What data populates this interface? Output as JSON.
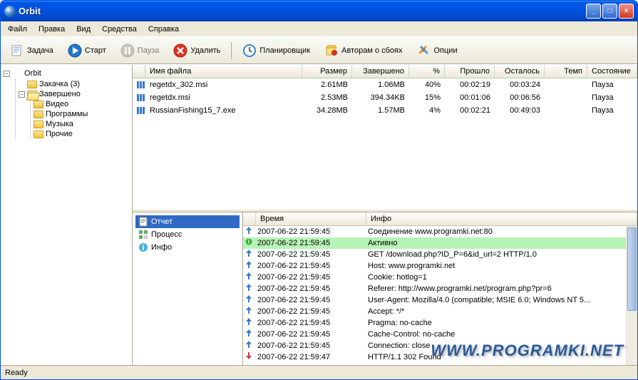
{
  "app_title": "Orbit",
  "menu": [
    "Файл",
    "Правка",
    "Вид",
    "Средства",
    "Справка"
  ],
  "toolbar": [
    {
      "label": "Задача",
      "icon": "new"
    },
    {
      "label": "Старт",
      "icon": "play"
    },
    {
      "label": "Пауза",
      "icon": "pause",
      "disabled": true
    },
    {
      "label": "Удалить",
      "icon": "delete"
    },
    {
      "sep": true
    },
    {
      "label": "Планировщик",
      "icon": "sched"
    },
    {
      "label": "Авторам о сбоях",
      "icon": "bug"
    },
    {
      "label": "Опции",
      "icon": "opts"
    }
  ],
  "tree": {
    "root": "Orbit",
    "n1": "Закачка  (3)",
    "n2": "Завершено",
    "c1": "Видео",
    "c2": "Программы",
    "c3": "Музыка",
    "c4": "Прочие"
  },
  "columns": {
    "name": "Имя файла",
    "size": "Размер",
    "done": "Завершено",
    "pct": "%",
    "elapsed": "Прошло",
    "remain": "Осталось",
    "temp": "Темп",
    "state": "Состояние"
  },
  "rows": [
    {
      "name": "regetdx_302.msi",
      "size": "2.61MB",
      "done": "1.06MB",
      "pct": "40%",
      "elapsed": "00:02:19",
      "remain": "00:03:24",
      "temp": "",
      "state": "Пауза"
    },
    {
      "name": "regetdx.msi",
      "size": "2.53MB",
      "done": "394.34KB",
      "pct": "15%",
      "elapsed": "00:01:06",
      "remain": "00:06:56",
      "temp": "",
      "state": "Пауза"
    },
    {
      "name": "RussianFishing15_7.exe",
      "size": "34.28MB",
      "done": "1.57MB",
      "pct": "4%",
      "elapsed": "00:02:21",
      "remain": "00:49:03",
      "temp": "",
      "state": "Пауза"
    }
  ],
  "tabs": {
    "report": "Отчет",
    "process": "Процесс",
    "info": "Инфо"
  },
  "log_cols": {
    "time": "Время",
    "info": "Инфо"
  },
  "log": [
    {
      "t": "2007-06-22 21:59:45",
      "i": "Соединение www.programki.net:80",
      "type": "up"
    },
    {
      "t": "2007-06-22 21:59:45",
      "i": "Активно",
      "type": "active"
    },
    {
      "t": "2007-06-22 21:59:45",
      "i": "GET /download.php?ID_P=6&id_url=2 HTTP/1.0",
      "type": "up"
    },
    {
      "t": "2007-06-22 21:59:45",
      "i": "Host: www.programki.net",
      "type": "up"
    },
    {
      "t": "2007-06-22 21:59:45",
      "i": "Cookie: hotlog=1",
      "type": "up"
    },
    {
      "t": "2007-06-22 21:59:45",
      "i": "Referer: http://www.programki.net/program.php?pr=6",
      "type": "up"
    },
    {
      "t": "2007-06-22 21:59:45",
      "i": "User-Agent: Mozilla/4.0 (compatible; MSIE 6.0; Windows NT 5...",
      "type": "up"
    },
    {
      "t": "2007-06-22 21:59:45",
      "i": "Accept: */*",
      "type": "up"
    },
    {
      "t": "2007-06-22 21:59:45",
      "i": "Pragma: no-cache",
      "type": "up"
    },
    {
      "t": "2007-06-22 21:59:45",
      "i": "Cache-Control: no-cache",
      "type": "up"
    },
    {
      "t": "2007-06-22 21:59:45",
      "i": "Connection: close",
      "type": "up"
    },
    {
      "t": "2007-06-22 21:59:47",
      "i": "HTTP/1.1 302 Found",
      "type": "down"
    }
  ],
  "status": "Ready",
  "watermark": "WWW.PROGRAMKI.NET"
}
